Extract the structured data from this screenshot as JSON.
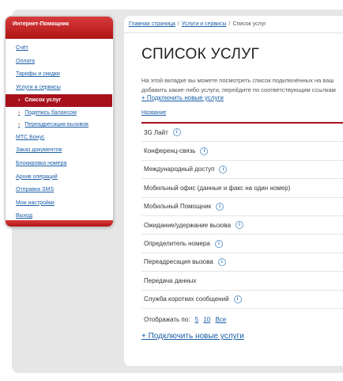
{
  "sidebar": {
    "title": "Интернет-Помощник",
    "items": [
      {
        "label": "Счёт"
      },
      {
        "label": "Оплата"
      },
      {
        "label": "Тарифы и скидки"
      },
      {
        "label": "Услуги и сервисы"
      },
      {
        "label": "Список услуг"
      },
      {
        "label": "Подепись балансом"
      },
      {
        "label": "Переадресация вызовов"
      },
      {
        "label": "МТС Бонус"
      },
      {
        "label": "Заказ документов"
      },
      {
        "label": "Блокировка номера"
      },
      {
        "label": "Архив операций"
      },
      {
        "label": "Отправка SMS"
      },
      {
        "label": "Мои настройки"
      },
      {
        "label": "Выход"
      }
    ]
  },
  "breadcrumb": {
    "home": "Главная страница",
    "section": "Услуги и сервисы",
    "current": "Список услуг",
    "separator": "/"
  },
  "page": {
    "title": "СПИСОК УСЛУГ",
    "intro_line1": "На этой вкладке вы можете посмотреть список подключённых на ваш",
    "intro_line2": "добавить какие-либо услуги, перейдите по соответствующим ссылкам",
    "connect_link": "+ Подключить новые услуги",
    "column_header": "Название",
    "info_glyph": "i"
  },
  "services": [
    {
      "name": "3G Лайт"
    },
    {
      "name": "Конференц-связь"
    },
    {
      "name": "Международный доступ"
    },
    {
      "name": "Мобильный офис (данные и факс на один номер)"
    },
    {
      "name": "Мобильный Помощник"
    },
    {
      "name": "Ожидание/удержание вызова"
    },
    {
      "name": "Определитель номера"
    },
    {
      "name": "Переадресация вызова"
    },
    {
      "name": "Передача данных"
    },
    {
      "name": "Служба коротких сообщений"
    }
  ],
  "paging": {
    "label": "Отображать по:",
    "options": [
      "5",
      "10",
      "Все"
    ]
  },
  "connect_bottom": "+ Подключить новые услуги",
  "colors": {
    "accent_red": "#a8111c",
    "link_blue": "#1a5ea8"
  }
}
